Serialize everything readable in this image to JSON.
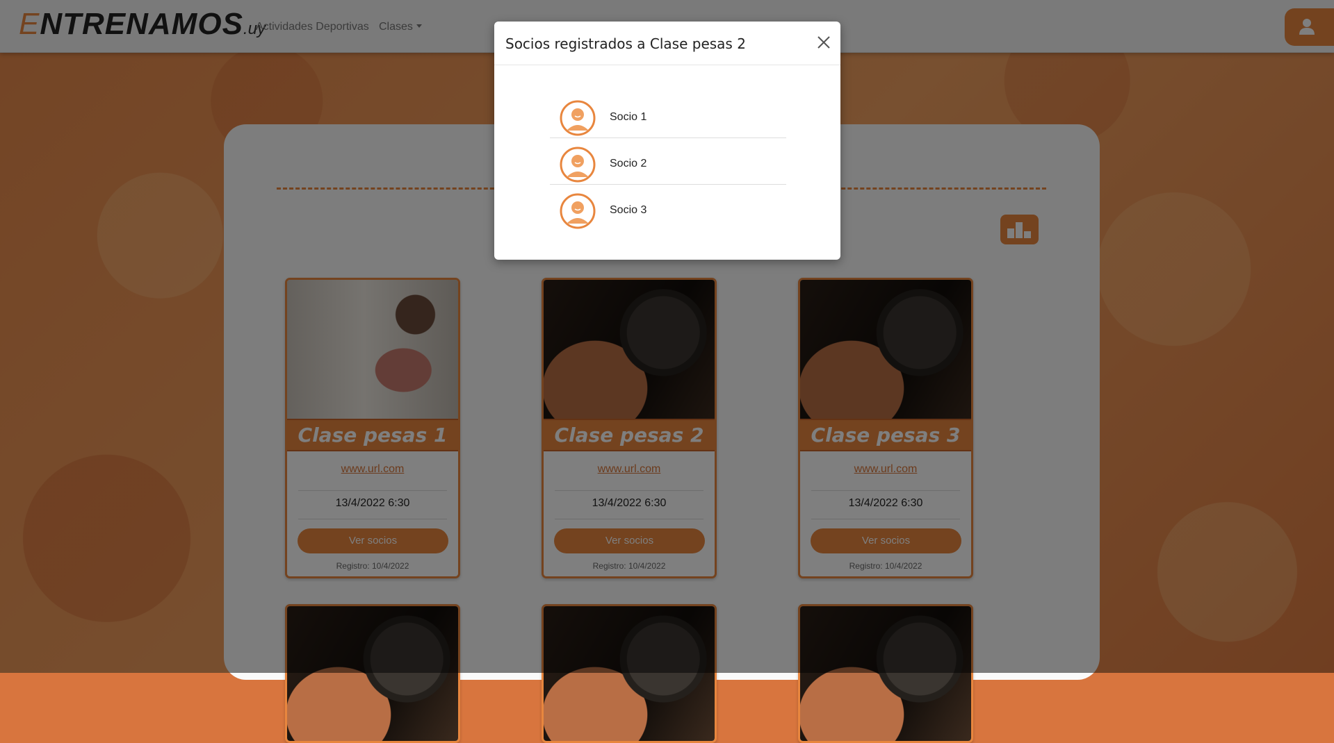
{
  "navbar": {
    "brand_first": "E",
    "brand_rest": "NTRENAMOS",
    "brand_tld": ".uy",
    "links": [
      "Actividades Deportivas",
      "Clases"
    ]
  },
  "cards": [
    {
      "title": "Clase pesas 1",
      "url": "www.url.com",
      "date": "13/4/2022 6:30",
      "button": "Ver socios",
      "registro": "Registro: 10/4/2022"
    },
    {
      "title": "Clase pesas 2",
      "url": "www.url.com",
      "date": "13/4/2022 6:30",
      "button": "Ver socios",
      "registro": "Registro: 10/4/2022"
    },
    {
      "title": "Clase pesas 3",
      "url": "www.url.com",
      "date": "13/4/2022 6:30",
      "button": "Ver socios",
      "registro": "Registro: 10/4/2022"
    }
  ],
  "modal": {
    "title": "Socios registrados a Clase pesas 2",
    "socios": [
      "Socio 1",
      "Socio 2",
      "Socio 3"
    ]
  },
  "colors": {
    "accent": "#e8863e",
    "overlay": "rgba(0,0,0,0.5)"
  }
}
